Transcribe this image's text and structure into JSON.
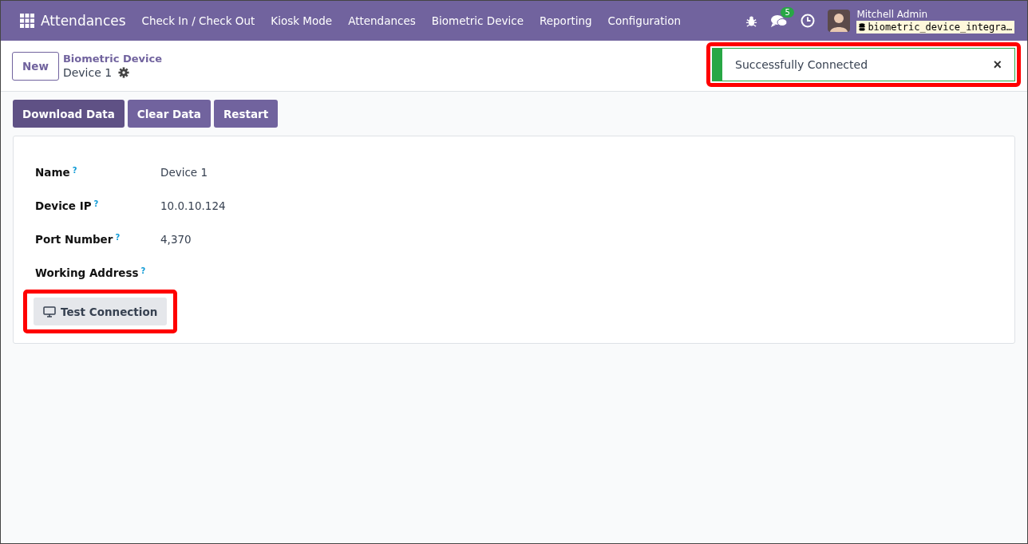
{
  "navbar": {
    "app_name": "Attendances",
    "menu": [
      "Check In / Check Out",
      "Kiosk Mode",
      "Attendances",
      "Biometric Device",
      "Reporting",
      "Configuration"
    ],
    "messages_count": "5",
    "user_name": "Mitchell Admin",
    "database": "biometric_device_integra…"
  },
  "control_panel": {
    "new_button": "New",
    "breadcrumb": "Biometric Device",
    "record_name": "Device 1"
  },
  "notification": {
    "message": "Successfully Connected",
    "close": "×",
    "highlighted": true
  },
  "action_buttons": [
    {
      "label": "Download Data",
      "kind": "primary"
    },
    {
      "label": "Clear Data",
      "kind": "secondary"
    },
    {
      "label": "Restart",
      "kind": "secondary"
    }
  ],
  "fields": [
    {
      "label": "Name",
      "help": "?",
      "value": "Device 1"
    },
    {
      "label": "Device IP",
      "help": "?",
      "value": "10.0.10.124"
    },
    {
      "label": "Port Number",
      "help": "?",
      "value": "4,370"
    },
    {
      "label": "Working Address",
      "help": "?"
    }
  ],
  "test_button": {
    "label": "Test Connection",
    "highlighted": true
  }
}
